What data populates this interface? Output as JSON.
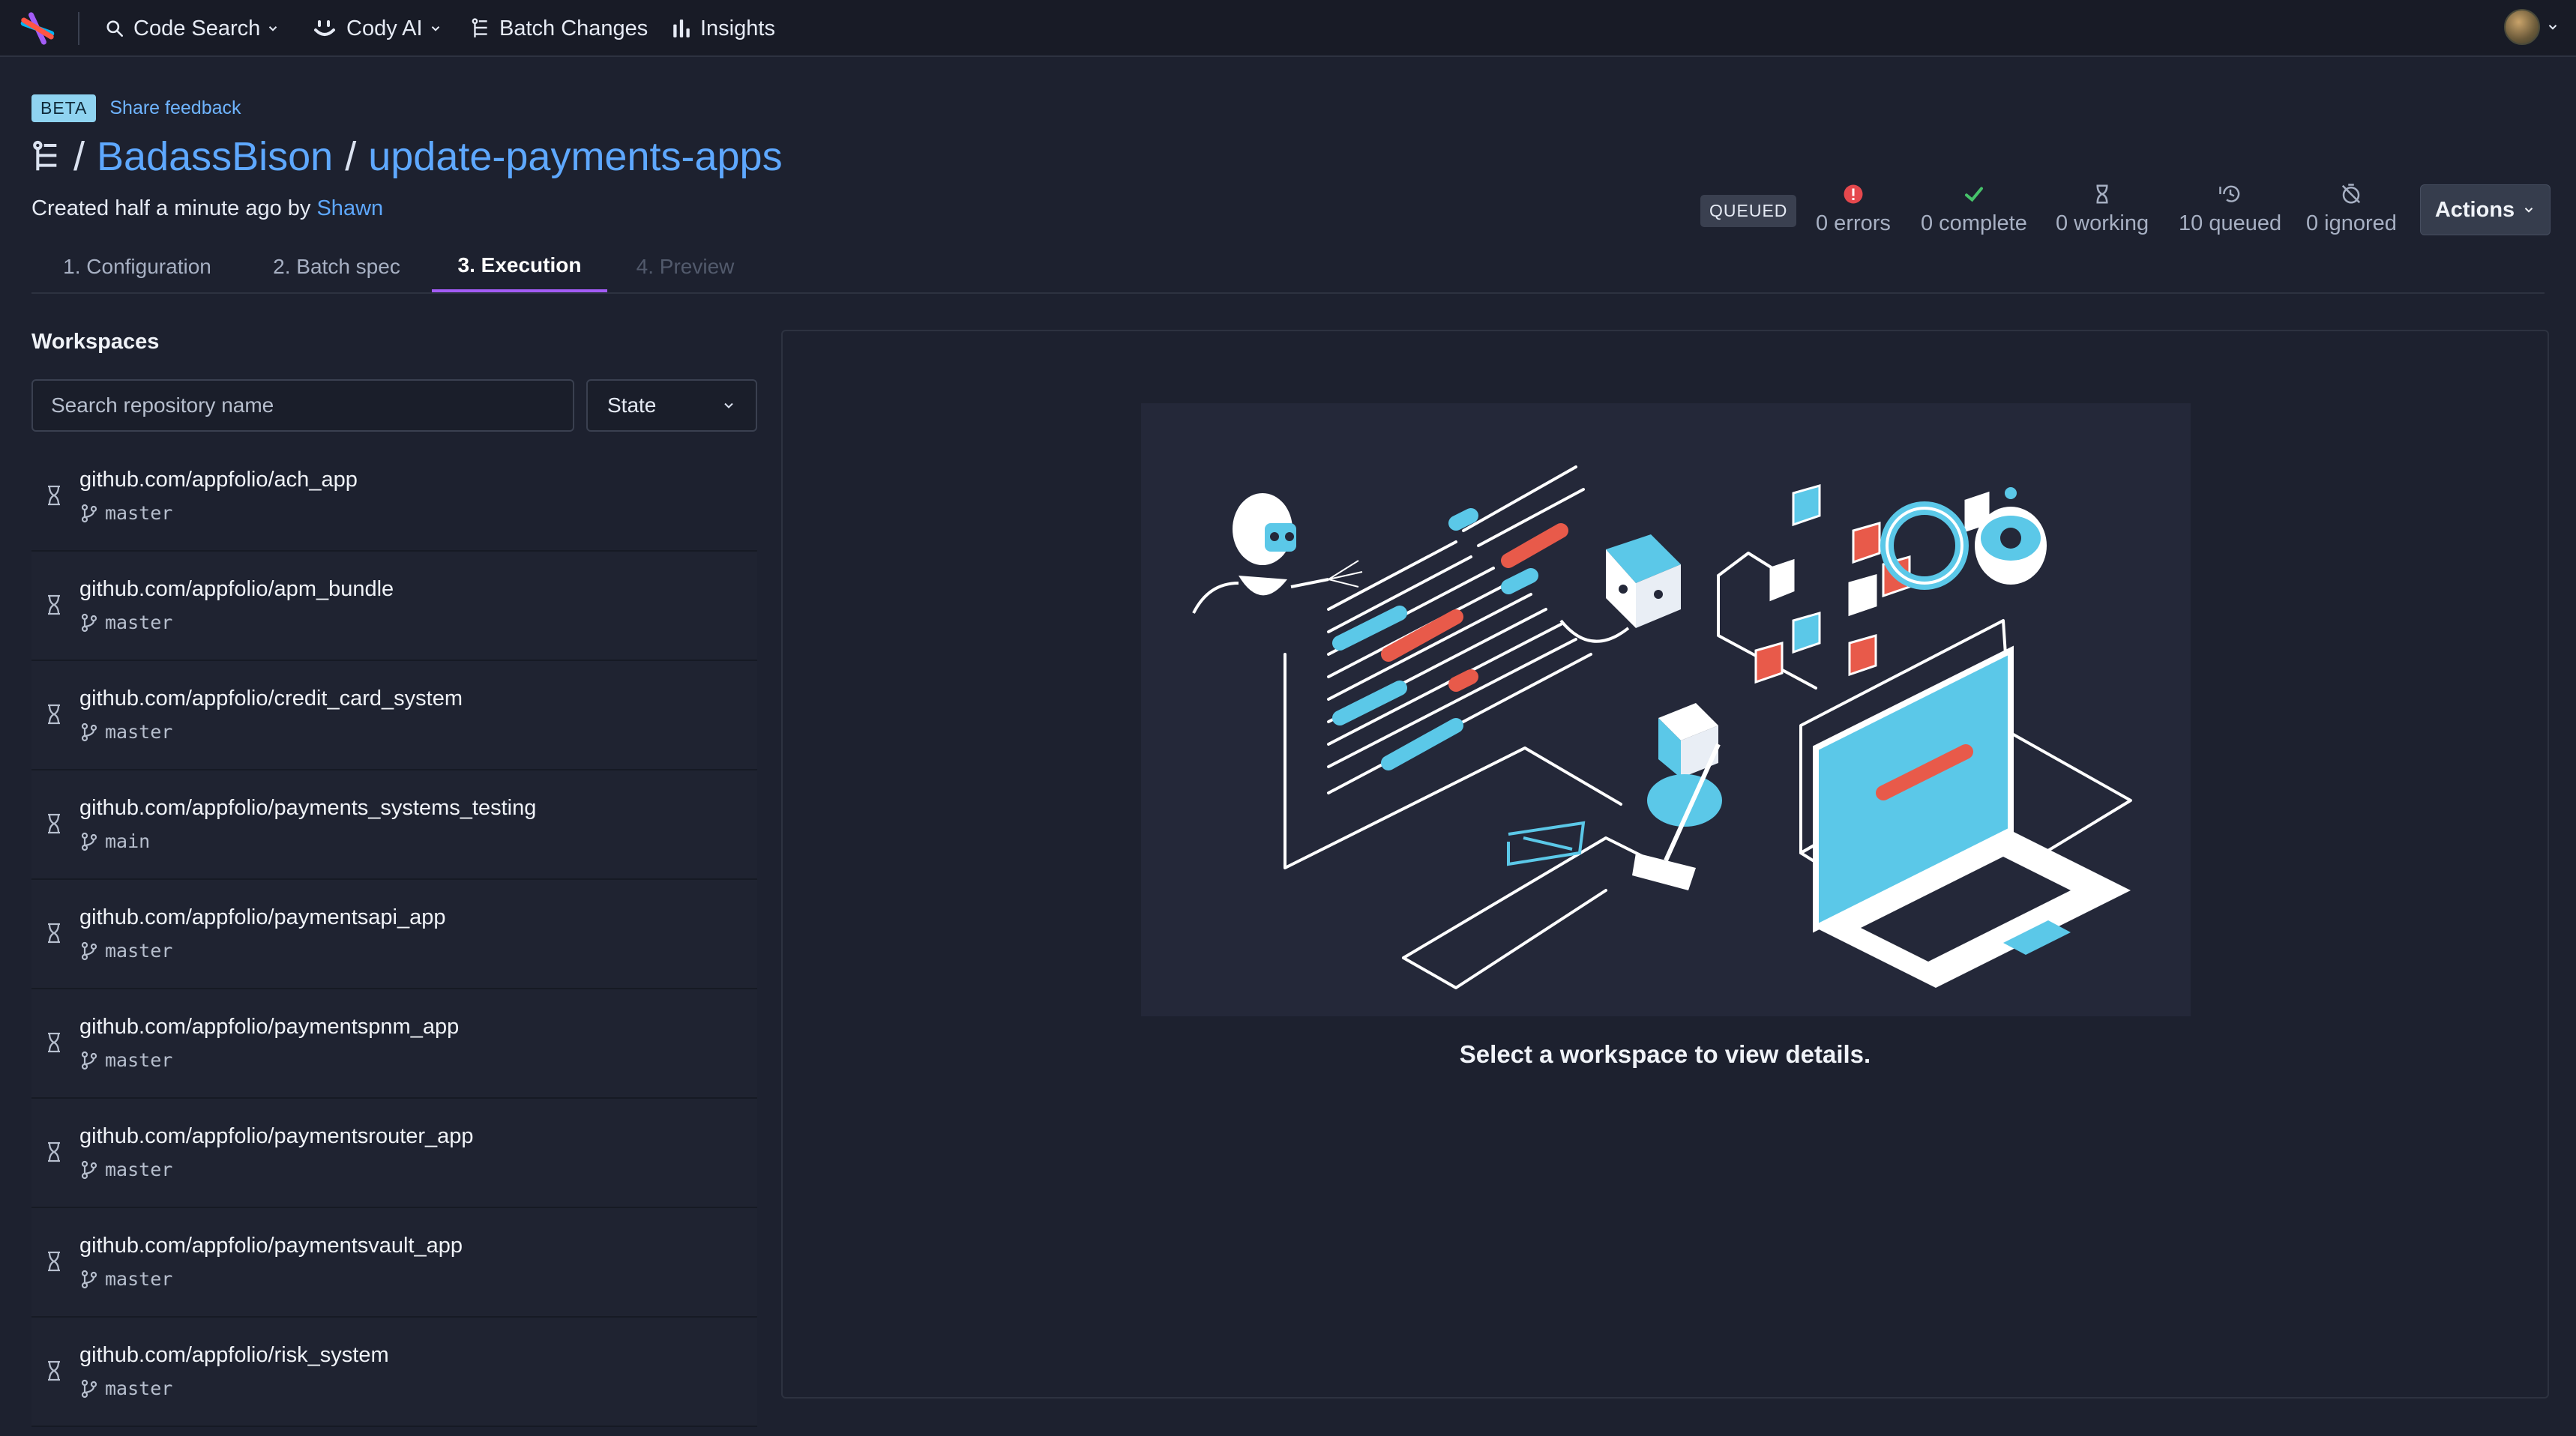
{
  "nav": {
    "items": [
      {
        "label": "Code Search",
        "icon": "search-icon",
        "dropdown": true
      },
      {
        "label": "Cody AI",
        "icon": "cody-icon",
        "dropdown": true
      },
      {
        "label": "Batch Changes",
        "icon": "batch-changes-icon",
        "dropdown": false
      },
      {
        "label": "Insights",
        "icon": "insights-icon",
        "dropdown": false
      }
    ]
  },
  "header": {
    "beta_label": "BETA",
    "share_feedback": "Share feedback",
    "namespace": "BadassBison",
    "separator": "/",
    "batch_change_name": "update-payments-apps",
    "created_prefix": "Created half a minute ago by ",
    "author": "Shawn"
  },
  "tabs": [
    {
      "label": "1. Configuration",
      "state": "normal"
    },
    {
      "label": "2. Batch spec",
      "state": "normal"
    },
    {
      "label": "3. Execution",
      "state": "active"
    },
    {
      "label": "4. Preview",
      "state": "disabled"
    }
  ],
  "status": {
    "badge": "QUEUED",
    "stats": [
      {
        "label": "0 errors",
        "icon": "error-icon",
        "color": "#e5484d"
      },
      {
        "label": "0 complete",
        "icon": "check-icon",
        "color": "#46c26a"
      },
      {
        "label": "0 working",
        "icon": "hourglass-icon",
        "color": "#a7b0c3"
      },
      {
        "label": "10 queued",
        "icon": "timer-history-icon",
        "color": "#a7b0c3"
      },
      {
        "label": "0 ignored",
        "icon": "timer-off-icon",
        "color": "#a7b0c3"
      }
    ],
    "actions_label": "Actions"
  },
  "workspaces": {
    "heading": "Workspaces",
    "search_placeholder": "Search repository name",
    "state_label": "State",
    "items": [
      {
        "repo": "github.com/appfolio/ach_app",
        "branch": "master"
      },
      {
        "repo": "github.com/appfolio/apm_bundle",
        "branch": "master"
      },
      {
        "repo": "github.com/appfolio/credit_card_system",
        "branch": "master"
      },
      {
        "repo": "github.com/appfolio/payments_systems_testing",
        "branch": "main"
      },
      {
        "repo": "github.com/appfolio/paymentsapi_app",
        "branch": "master"
      },
      {
        "repo": "github.com/appfolio/paymentspnm_app",
        "branch": "master"
      },
      {
        "repo": "github.com/appfolio/paymentsrouter_app",
        "branch": "master"
      },
      {
        "repo": "github.com/appfolio/paymentsvault_app",
        "branch": "master"
      },
      {
        "repo": "github.com/appfolio/risk_system",
        "branch": "master"
      }
    ]
  },
  "detail": {
    "empty_message": "Select a workspace to view details."
  },
  "colors": {
    "background": "#1d212f",
    "link": "#5ea8ff",
    "active_tab": "#a35cf6",
    "accent_blue": "#5bc8e8",
    "accent_red": "#e85a4a"
  }
}
